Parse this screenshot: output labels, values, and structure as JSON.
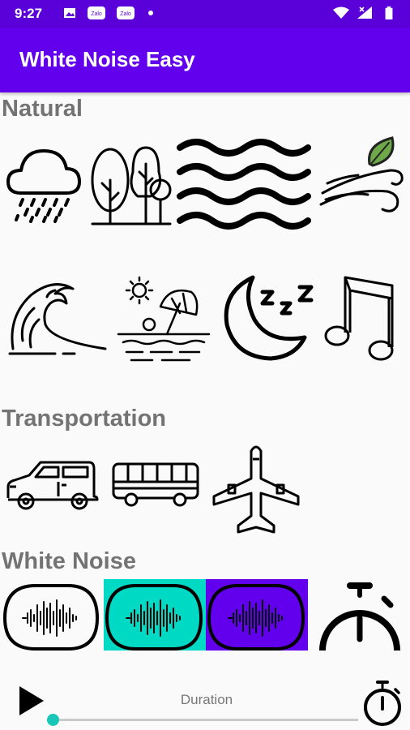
{
  "status_bar": {
    "time": "9:27",
    "left_icons": [
      "image-icon",
      "zalo-icon",
      "zalo-icon",
      "dot-icon"
    ],
    "zalo_label": "Zalo",
    "right_icons": [
      "wifi-icon",
      "signal-icon",
      "battery-icon"
    ]
  },
  "app_bar": {
    "title": "White Noise Easy"
  },
  "sections": {
    "natural": {
      "title": "Natural",
      "items": [
        "rain-cloud-icon",
        "forest-icon",
        "waves-icon",
        "wind-leaf-icon",
        "ocean-wave-icon",
        "beach-umbrella-icon",
        "night-moon-icon",
        "music-note-icon"
      ]
    },
    "transportation": {
      "title": "Transportation",
      "items": [
        "car-icon",
        "bus-icon",
        "airplane-icon"
      ]
    },
    "white_noise": {
      "title": "White Noise",
      "items": [
        "white-noise-icon",
        "pink-noise-icon",
        "brown-noise-icon",
        "stopwatch-icon"
      ]
    }
  },
  "colors": {
    "primary": "#6200ee",
    "status_bar": "#5a00d8",
    "accent_teal": "#00dac5",
    "accent_purple": "#6200ee",
    "section_title": "#737373",
    "slider_thumb": "#18c7b8"
  },
  "player": {
    "duration_label": "Duration",
    "progress": 0
  }
}
